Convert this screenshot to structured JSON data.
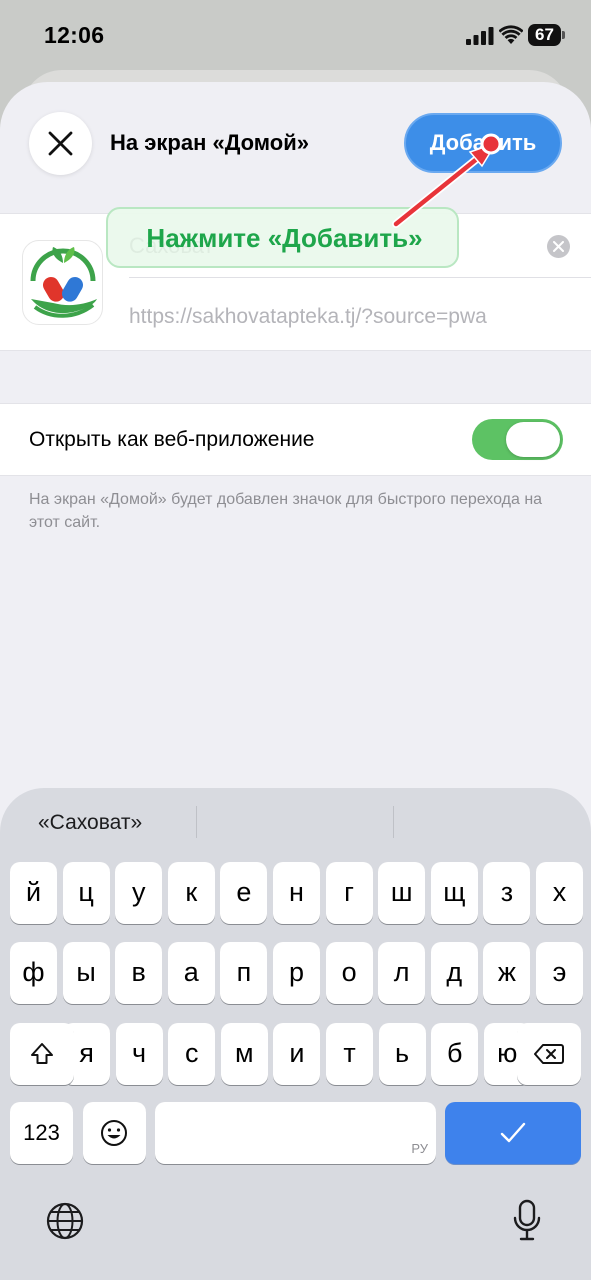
{
  "status_bar": {
    "time": "12:06",
    "battery": "67"
  },
  "sheet": {
    "title": "На экран «Домой»",
    "add_button": "Добавить"
  },
  "app": {
    "name_value": "Саховат",
    "url": "https://sakhovatapteka.tj/?source=pwa"
  },
  "web_app": {
    "label": "Открыть как веб-приложение",
    "enabled": true
  },
  "footnote": "На экран «Домой» будет добавлен значок для быстрого перехода на этот сайт.",
  "callout": "Нажмите «Добавить»",
  "keyboard": {
    "suggestion": "«Саховат»",
    "row1": [
      "й",
      "ц",
      "у",
      "к",
      "е",
      "н",
      "г",
      "ш",
      "щ",
      "з",
      "х"
    ],
    "row2": [
      "ф",
      "ы",
      "в",
      "а",
      "п",
      "р",
      "о",
      "л",
      "д",
      "ж",
      "э"
    ],
    "row3": [
      "я",
      "ч",
      "с",
      "м",
      "и",
      "т",
      "ь",
      "б",
      "ю"
    ],
    "numbers_key": "123",
    "space_lang": "РУ"
  },
  "colors": {
    "accent": "#3d8ee8",
    "toggle_on": "#5dc264",
    "callout_text": "#1ea64b",
    "arrow": "#e8343a"
  }
}
